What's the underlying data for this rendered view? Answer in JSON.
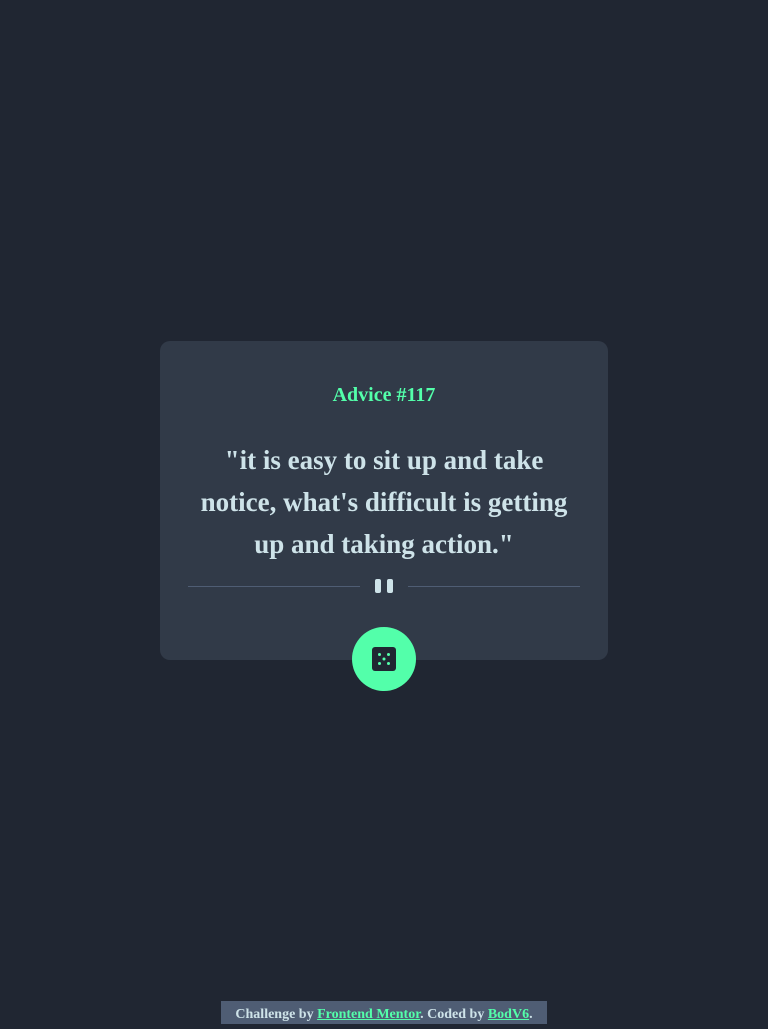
{
  "advice": {
    "id_label": "Advice #117",
    "text": "\"it is easy to sit up and take notice, what's difficult is getting up and taking action.\""
  },
  "controls": {
    "dice_icon_name": "dice-icon",
    "pause_icon_name": "pause-icon"
  },
  "attribution": {
    "prefix": "Challenge by ",
    "challenge_link": "Frontend Mentor",
    "middle": ". Coded by ",
    "author_link": "BodV6",
    "suffix": "."
  },
  "colors": {
    "background": "#202632",
    "card": "#313a48",
    "accent": "#53ffaa",
    "text": "#cee3e9",
    "divider": "#4f5d74"
  }
}
